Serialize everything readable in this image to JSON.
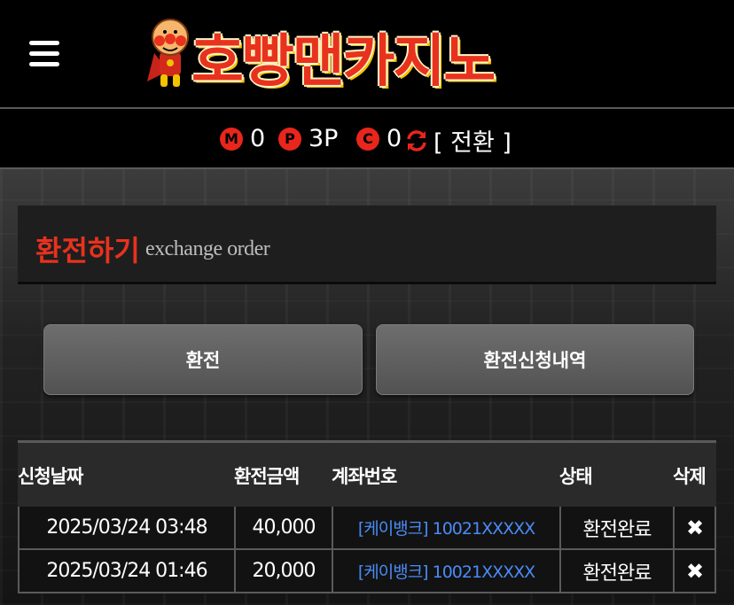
{
  "header": {
    "logo_text": "호빵맨카지노",
    "menu_icon": "hamburger-menu-icon",
    "mascot_icon": "mascot-logo-icon"
  },
  "balance": {
    "money": {
      "badge": "M",
      "value": "0"
    },
    "point": {
      "badge": "P",
      "value": "3P"
    },
    "casino": {
      "badge": "C",
      "value": "0"
    },
    "refresh_icon": "refresh-icon",
    "switch_label": "[ 전환 ]"
  },
  "colors": {
    "accent": "#e8321e",
    "link": "#4a8bf5",
    "badge": "#e8261b"
  },
  "page_title": {
    "korean": "환전하기",
    "english": "exchange order"
  },
  "tabs": {
    "exchange": "환전",
    "history": "환전신청내역"
  },
  "table": {
    "headers": {
      "date": "신청날짜",
      "amount": "환전금액",
      "account": "계좌번호",
      "status": "상태",
      "delete": "삭제"
    },
    "rows": [
      {
        "date": "2025/03/24 03:48",
        "amount": "40,000",
        "account": "[케이뱅크] 10021XXXXX",
        "status": "환전완료",
        "delete": "✖"
      },
      {
        "date": "2025/03/24 01:46",
        "amount": "20,000",
        "account": "[케이뱅크] 10021XXXXX",
        "status": "환전완료",
        "delete": "✖"
      }
    ]
  }
}
